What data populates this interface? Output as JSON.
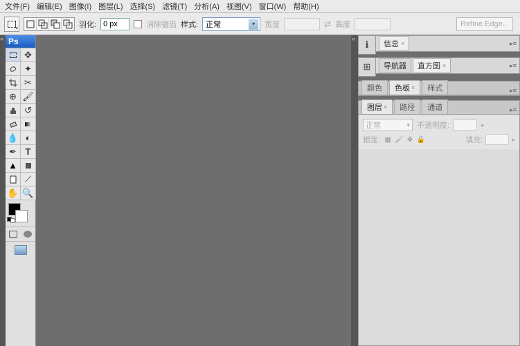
{
  "menu": {
    "file": "文件(F)",
    "edit": "编辑(E)",
    "image": "图像(I)",
    "layer": "图层(L)",
    "select": "选择(S)",
    "filter": "滤镜(T)",
    "analysis": "分析(A)",
    "view": "视图(V)",
    "window": "窗口(W)",
    "help": "帮助(H)"
  },
  "options": {
    "feather_label": "羽化:",
    "feather_value": "0 px",
    "antialias": "消除锯齿",
    "style_label": "样式:",
    "style_value": "正常",
    "width_label": "宽度",
    "height_label": "高度",
    "refine": "Refine Edge..."
  },
  "toolbox": {
    "header": "Ps"
  },
  "panels": {
    "info_tab": "信息",
    "navigator_tab": "导航器",
    "histogram_tab": "直方图",
    "color_tab": "颜色",
    "swatches_tab": "色板",
    "styles_tab": "样式",
    "layers_tab": "图层",
    "paths_tab": "路径",
    "channels_tab": "通道"
  },
  "layers": {
    "mode": "正常",
    "opacity_label": "不透明度:",
    "lock_label": "锁定:",
    "fill_label": "填充:"
  }
}
